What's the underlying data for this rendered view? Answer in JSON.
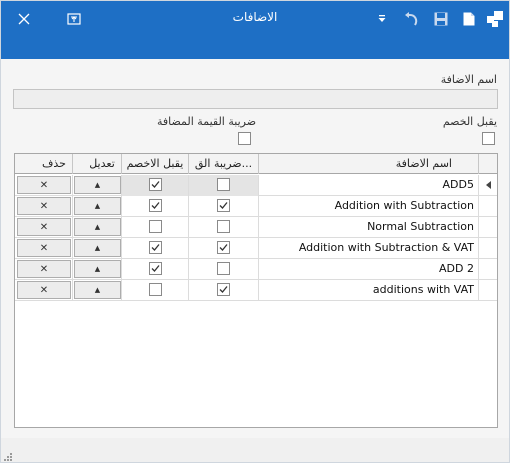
{
  "window": {
    "title": "الاضافات",
    "colors": {
      "titlebar": "#1e6fc5",
      "accent_white": "#ffffff"
    },
    "toolbar_icons": [
      "grid-icon",
      "new-document-icon",
      "save-icon",
      "undo-icon",
      "dropdown-arrow-icon"
    ],
    "right_icons": [
      "restore-window-icon",
      "close-icon"
    ]
  },
  "form": {
    "name_label": "اسم الاضافة",
    "name_value": "",
    "vat_label": "ضريبة القيمة المضافة",
    "discount_label": "يقبل الخصم"
  },
  "grid": {
    "headers": {
      "name": "اسم الاضافة",
      "vat": "ضريبة الق...",
      "discount": "يقبل الاخصم",
      "edit": "تعديل",
      "delete": "حذف"
    },
    "rows": [
      {
        "name": "ADD5",
        "vat": false,
        "discount": true,
        "edit": "▲",
        "delete": "✕",
        "current": true
      },
      {
        "name": "Addition with Subtraction",
        "vat": true,
        "discount": true,
        "edit": "▲",
        "delete": "✕",
        "current": false
      },
      {
        "name": "Normal Subtraction",
        "vat": false,
        "discount": false,
        "edit": "▲",
        "delete": "✕",
        "current": false
      },
      {
        "name": "Addition with Subtraction & VAT",
        "vat": true,
        "discount": true,
        "edit": "▲",
        "delete": "✕",
        "current": false
      },
      {
        "name": "ADD 2",
        "vat": false,
        "discount": true,
        "edit": "▲",
        "delete": "✕",
        "current": false
      },
      {
        "name": "additions with VAT",
        "vat": true,
        "discount": false,
        "edit": "▲",
        "delete": "✕",
        "current": false
      }
    ]
  }
}
